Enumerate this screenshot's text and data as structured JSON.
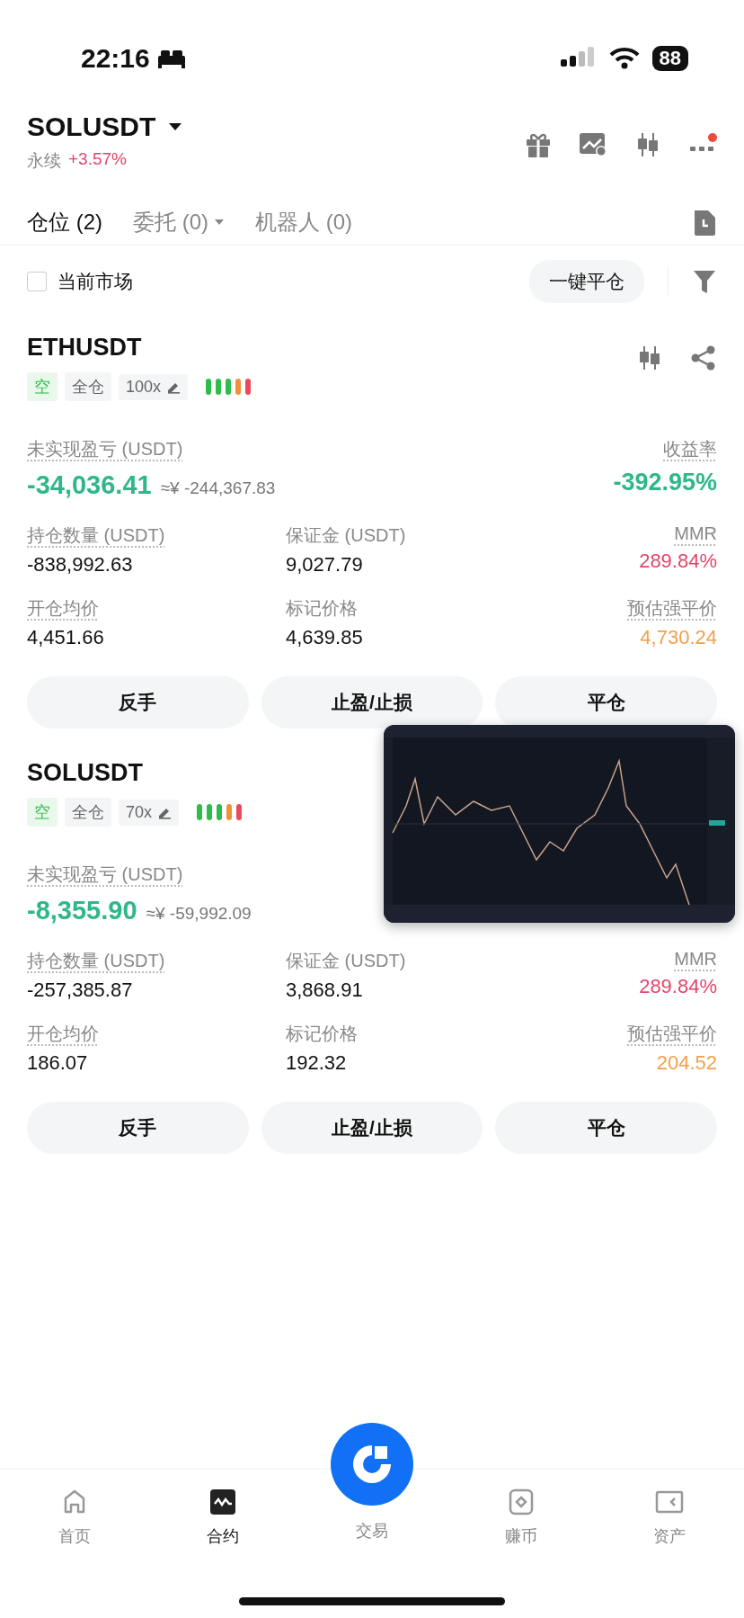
{
  "status_bar": {
    "time": "22:16",
    "battery": "88"
  },
  "header": {
    "symbol": "SOLUSDT",
    "type": "永续",
    "change": "+3.57%"
  },
  "tabs": [
    {
      "label": "仓位 (2)",
      "selected": true,
      "dropdown": false
    },
    {
      "label": "委托 (0)",
      "selected": false,
      "dropdown": true
    },
    {
      "label": "机器人 (0)",
      "selected": false,
      "dropdown": false
    }
  ],
  "filter": {
    "label": "当前市场",
    "checked": false,
    "close_all": "一键平仓"
  },
  "positions": [
    {
      "symbol": "ETHUSDT",
      "card_tools": true,
      "side": "空",
      "margin_mode": "全仓",
      "leverage": "100x",
      "risk": [
        {
          "color": "#2ebd4a"
        },
        {
          "color": "#2ebd4a"
        },
        {
          "color": "#2ebd4a"
        },
        {
          "color": "#f0913a"
        },
        {
          "color": "#ea4b5a"
        }
      ],
      "pnl_label": "未实现盈亏 (USDT)",
      "pnl": "-34,036.41",
      "pnl_cny": "≈¥ -244,367.83",
      "roe_label": "收益率",
      "roe": "-392.95%",
      "stats": [
        {
          "label": "持仓数量 (USDT)",
          "value": "-838,992.63",
          "color": "#111111",
          "dotted": true
        },
        {
          "label": "保证金 (USDT)",
          "value": "9,027.79",
          "color": "#111111",
          "dotted": false
        },
        {
          "label": "MMR",
          "value": "289.84%",
          "color": "#e0456a",
          "dotted": true
        },
        {
          "label": "开仓均价",
          "value": "4,451.66",
          "color": "#111111",
          "dotted": true
        },
        {
          "label": "标记价格",
          "value": "4,639.85",
          "color": "#111111",
          "dotted": false
        },
        {
          "label": "预估强平价",
          "value": "4,730.24",
          "color": "#f0a04b",
          "dotted": true
        }
      ],
      "actions": [
        "反手",
        "止盈/止损",
        "平仓"
      ]
    },
    {
      "symbol": "SOLUSDT",
      "side": "空",
      "margin_mode": "全仓",
      "leverage": "70x",
      "risk": [
        {
          "color": "#2ebd4a"
        },
        {
          "color": "#2ebd4a"
        },
        {
          "color": "#2ebd4a"
        },
        {
          "color": "#f0913a"
        },
        {
          "color": "#ea4b5a"
        }
      ],
      "pnl_label": "未实现盈亏 (USDT)",
      "pnl": "-8,355.90",
      "pnl_cny": "≈¥ -59,992.09",
      "stats": [
        {
          "label": "持仓数量 (USDT)",
          "value": "-257,385.87",
          "color": "#111111",
          "dotted": true
        },
        {
          "label": "保证金 (USDT)",
          "value": "3,868.91",
          "color": "#111111",
          "dotted": false
        },
        {
          "label": "MMR",
          "value": "289.84%",
          "color": "#e0456a",
          "dotted": true
        },
        {
          "label": "开仓均价",
          "value": "186.07",
          "color": "#111111",
          "dotted": true
        },
        {
          "label": "标记价格",
          "value": "192.32",
          "color": "#111111",
          "dotted": false
        },
        {
          "label": "预估强平价",
          "value": "204.52",
          "color": "#f0a04b",
          "dotted": true
        }
      ],
      "actions": [
        "反手",
        "止盈/止损",
        "平仓"
      ]
    }
  ],
  "nav": [
    {
      "label": "首页",
      "kind": "home",
      "selected": false
    },
    {
      "label": "合约",
      "kind": "futures",
      "selected": true
    },
    {
      "label": "交易",
      "kind": "trade",
      "selected": false
    },
    {
      "label": "赚币",
      "kind": "earn",
      "selected": false
    },
    {
      "label": "资产",
      "kind": "assets",
      "selected": false
    }
  ]
}
